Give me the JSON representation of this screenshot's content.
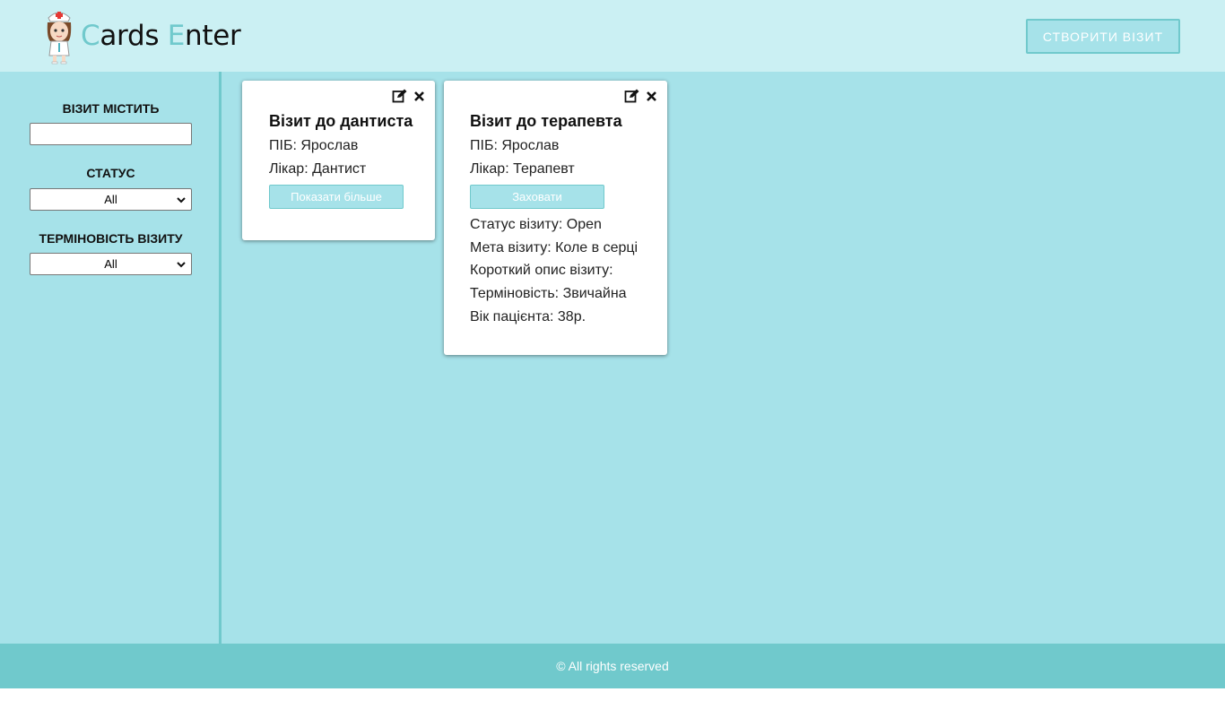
{
  "header": {
    "logo_first_letter": "C",
    "logo_rest_1": "ards ",
    "logo_second_letter": "E",
    "logo_rest_2": "nter",
    "create_button": "СТВОРИТИ ВІЗИТ"
  },
  "sidebar": {
    "contains_label": "ВІЗИТ МІСТИТЬ",
    "contains_value": "",
    "status_label": "СТАТУС",
    "status_value": "All",
    "urgency_label": "ТЕРМІНОВІСТЬ ВІЗИТУ",
    "urgency_value": "All"
  },
  "cards": [
    {
      "title": "Візит до дантиста",
      "name_line": "ПІБ: Ярослав",
      "doctor_line": "Лікар: Дантист",
      "button": "Показати більше"
    },
    {
      "title": "Візит до терапевта",
      "name_line": "ПІБ: Ярослав",
      "doctor_line": "Лікар: Терапевт",
      "button": "Заховати",
      "details": [
        "Статус візиту: Open",
        "Мета візиту: Коле в серці",
        "Короткий опис візиту:",
        "Терміновість: Звичайна",
        "Вік пацієнта: 38р."
      ]
    }
  ],
  "footer": {
    "text": "© All rights reserved"
  },
  "colors": {
    "header_bg": "#cbf0f3",
    "main_bg": "#a6e2e9",
    "accent": "#70c9cc"
  },
  "icons": [
    "nurse-logo-icon",
    "edit-icon",
    "close-icon",
    "chevron-down-icon"
  ]
}
